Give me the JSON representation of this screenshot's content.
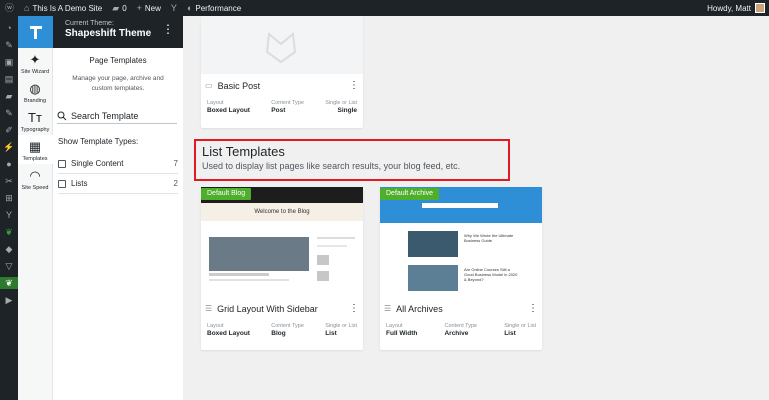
{
  "adminbar": {
    "site": "This Is A Demo Site",
    "comments": "0",
    "new": "New",
    "performance": "Performance",
    "howdy": "Howdy, Matt"
  },
  "theme_sidebar": {
    "items": [
      {
        "label": "Site Wizard",
        "icon": "wand-icon"
      },
      {
        "label": "Branding",
        "icon": "palette-icon"
      },
      {
        "label": "Typography",
        "icon": "typography-icon"
      },
      {
        "label": "Templates",
        "icon": "templates-icon"
      },
      {
        "label": "Site Speed",
        "icon": "speedometer-icon"
      }
    ]
  },
  "panel": {
    "subtitle": "Current Theme:",
    "title": "Shapeshift Theme",
    "section_title": "Page Templates",
    "description": "Manage your page, archive and custom templates.",
    "search_placeholder": "Search Template",
    "show_label": "Show Template Types:",
    "types": [
      {
        "label": "Single Content",
        "count": "7"
      },
      {
        "label": "Lists",
        "count": "2"
      }
    ]
  },
  "content": {
    "top_card": {
      "name": "Basic Post",
      "meta": [
        {
          "label": "Layout",
          "value": "Boxed Layout"
        },
        {
          "label": "Content Type",
          "value": "Post"
        },
        {
          "label": "Single or List",
          "value": "Single"
        }
      ]
    },
    "section": {
      "title": "List Templates",
      "description": "Used to display list pages like search results, your blog feed, etc."
    },
    "cards": [
      {
        "badge": "Default Blog",
        "preview_title": "Welcome to the Blog",
        "name": "Grid Layout With Sidebar",
        "meta": [
          {
            "label": "Layout",
            "value": "Boxed Layout"
          },
          {
            "label": "Content Type",
            "value": "Blog"
          },
          {
            "label": "Single or List",
            "value": "List"
          }
        ]
      },
      {
        "badge": "Default Archive",
        "preview_items": [
          "Why We Wrote the Ultimate Business Guide",
          "Are Online Courses Still a Good Business Model in 2020 & Beyond?"
        ],
        "name": "All Archives",
        "meta": [
          {
            "label": "Layout",
            "value": "Full Width"
          },
          {
            "label": "Content Type",
            "value": "Archive"
          },
          {
            "label": "Single or List",
            "value": "List"
          }
        ]
      }
    ]
  },
  "colors": {
    "accent": "#2f8fd6",
    "badge": "#4fae2c",
    "highlight": "#e01b24",
    "admin_bar": "#1d2327"
  }
}
